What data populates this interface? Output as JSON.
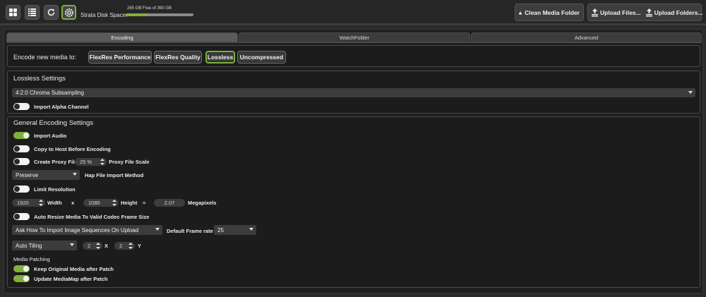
{
  "toolbar": {
    "disk_label": "Strata Disk Space:",
    "disk_free": "265 GB Free of 390 GB",
    "disk_used_fraction": 0.32,
    "clean_label": "Clean Media Folder",
    "upload_files_label": "Upload Files...",
    "upload_folders_label": "Upload Folders..."
  },
  "tabs": [
    {
      "label": "Encoding",
      "active": true
    },
    {
      "label": "WatchFolder",
      "active": false
    },
    {
      "label": "Advanced",
      "active": false
    }
  ],
  "encode": {
    "label": "Encode new media to:",
    "options": [
      "FlexRes Performance",
      "FlexRes Quality",
      "Lossless",
      "Uncompressed"
    ],
    "selected": "Lossless"
  },
  "lossless": {
    "title": "Lossless Settings",
    "subsampling": "4:2:0 Chroma Subsampling",
    "import_alpha": {
      "label": "Import Alpha Channel",
      "on": false
    }
  },
  "general": {
    "title": "General Encoding Settings",
    "import_audio": {
      "label": "Import Audio",
      "on": true
    },
    "copy_to_host": {
      "label": "Copy to Host Before Encoding",
      "on": false
    },
    "proxy": {
      "label": "Create Proxy File",
      "on": false,
      "scale_value": "25 %",
      "scale_label": "Proxy File Scale"
    },
    "hap": {
      "value": "Preserve",
      "label": "Hap File Import Method"
    },
    "limit_res": {
      "label": "Limit Resolution",
      "on": false
    },
    "width": {
      "value": "1920",
      "label": "Width"
    },
    "x_sep": "x",
    "height": {
      "value": "1080",
      "label": "Height"
    },
    "eq": "=",
    "megapixels": {
      "value": "2.07",
      "label": "Megapixels"
    },
    "auto_resize": {
      "label": "Auto Resize Media To Valid Codec Frame Size",
      "on": false
    },
    "image_seq": {
      "value": "Ask How To Import Image Sequences On Upload"
    },
    "frame_rate": {
      "label": "Default Frame rate",
      "value": "25"
    },
    "tiling": {
      "value": "Auto Tiling",
      "x_value": "2",
      "x_label": "X",
      "y_value": "2",
      "y_label": "Y"
    },
    "patching_title": "Media Patching",
    "keep_original": {
      "label": "Keep Original Media after Patch",
      "on": true
    },
    "update_mediamap": {
      "label": "Update MediaMap after Patch",
      "on": true
    }
  },
  "colors": {
    "accent": "#7fb13a",
    "bg": "#1f1f1f",
    "control": "#3c3c3c"
  }
}
